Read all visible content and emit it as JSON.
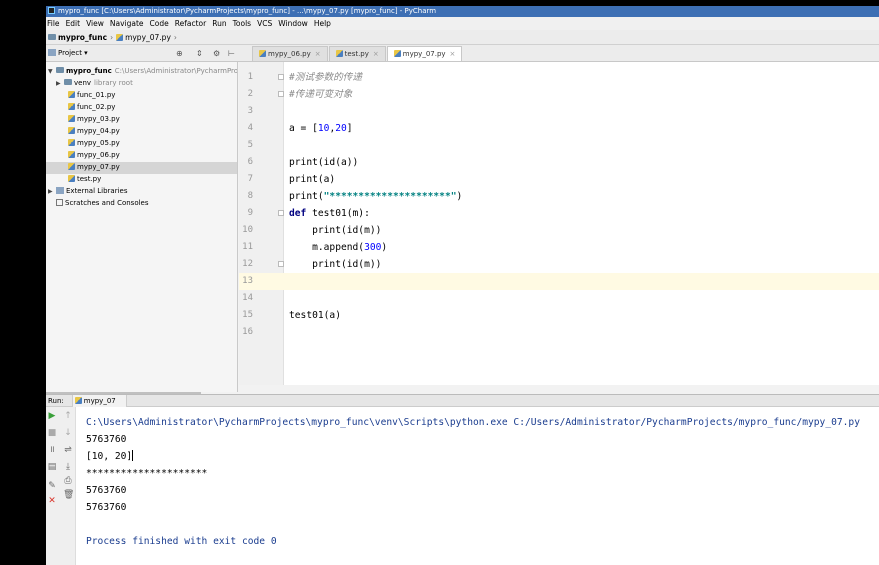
{
  "window": {
    "title": "mypro_func [C:\\Users\\Administrator\\PycharmProjects\\mypro_func] - ...\\mypy_07.py [mypro_func] - PyCharm"
  },
  "menu": [
    "File",
    "Edit",
    "View",
    "Navigate",
    "Code",
    "Refactor",
    "Run",
    "Tools",
    "VCS",
    "Window",
    "Help"
  ],
  "breadcrumb": {
    "project": "mypro_func",
    "file": "mypy_07.py"
  },
  "toolbar": {
    "project_selector": "Project"
  },
  "tabs": [
    {
      "label": "mypy_06.py",
      "active": false
    },
    {
      "label": "test.py",
      "active": false
    },
    {
      "label": "mypy_07.py",
      "active": true
    }
  ],
  "tree": {
    "root": {
      "name": "mypro_func",
      "path": "C:\\Users\\Administrator\\PycharmProjects"
    },
    "venv": {
      "name": "venv",
      "note": "library root"
    },
    "files": [
      "func_01.py",
      "func_02.py",
      "mypy_03.py",
      "mypy_04.py",
      "mypy_05.py",
      "mypy_06.py",
      "mypy_07.py",
      "test.py"
    ],
    "selected_file": "mypy_07.py",
    "external": "External Libraries",
    "scratches": "Scratches and Consoles"
  },
  "editor": {
    "line_numbers": [
      "1",
      "2",
      "3",
      "4",
      "5",
      "6",
      "7",
      "8",
      "9",
      "10",
      "11",
      "12",
      "13",
      "14",
      "15",
      "16"
    ],
    "current_line": 13,
    "lines": {
      "l1": "#测试参数的传递",
      "l2": "#传递可变对象",
      "l4_a": "a = [",
      "l4_n1": "10",
      "l4_c": ",",
      "l4_n2": "20",
      "l4_e": "]",
      "l6": "print(id(a))",
      "l7": "print(a)",
      "l8_a": "print(",
      "l8_s": "\"*********************\"",
      "l8_e": ")",
      "l9_kw": "def",
      "l9_rest": " test01(m):",
      "l10": "    print(id(m))",
      "l11_a": "    m.append(",
      "l11_n": "300",
      "l11_e": ")",
      "l12": "    print(id(m))",
      "l15": "test01(a)"
    }
  },
  "run": {
    "label": "Run:",
    "tab": "mypy_07",
    "output": [
      "C:\\Users\\Administrator\\PycharmProjects\\mypro_func\\venv\\Scripts\\python.exe C:/Users/Administrator/PycharmProjects/mypro_func/mypy_07.py",
      "5763760",
      "[10, 20]",
      "*********************",
      "5763760",
      "5763760",
      "",
      "Process finished with exit code 0"
    ]
  },
  "colors": {
    "title_bar": "#3d6fb4",
    "keyword": "#000080",
    "string": "#008080",
    "number": "#0000ff",
    "comment": "#8c8c8c",
    "console_path": "#1b3d8f",
    "current_line": "#fffae3",
    "run_icon": "#3aa03a",
    "stop_icon": "#d9342b"
  }
}
